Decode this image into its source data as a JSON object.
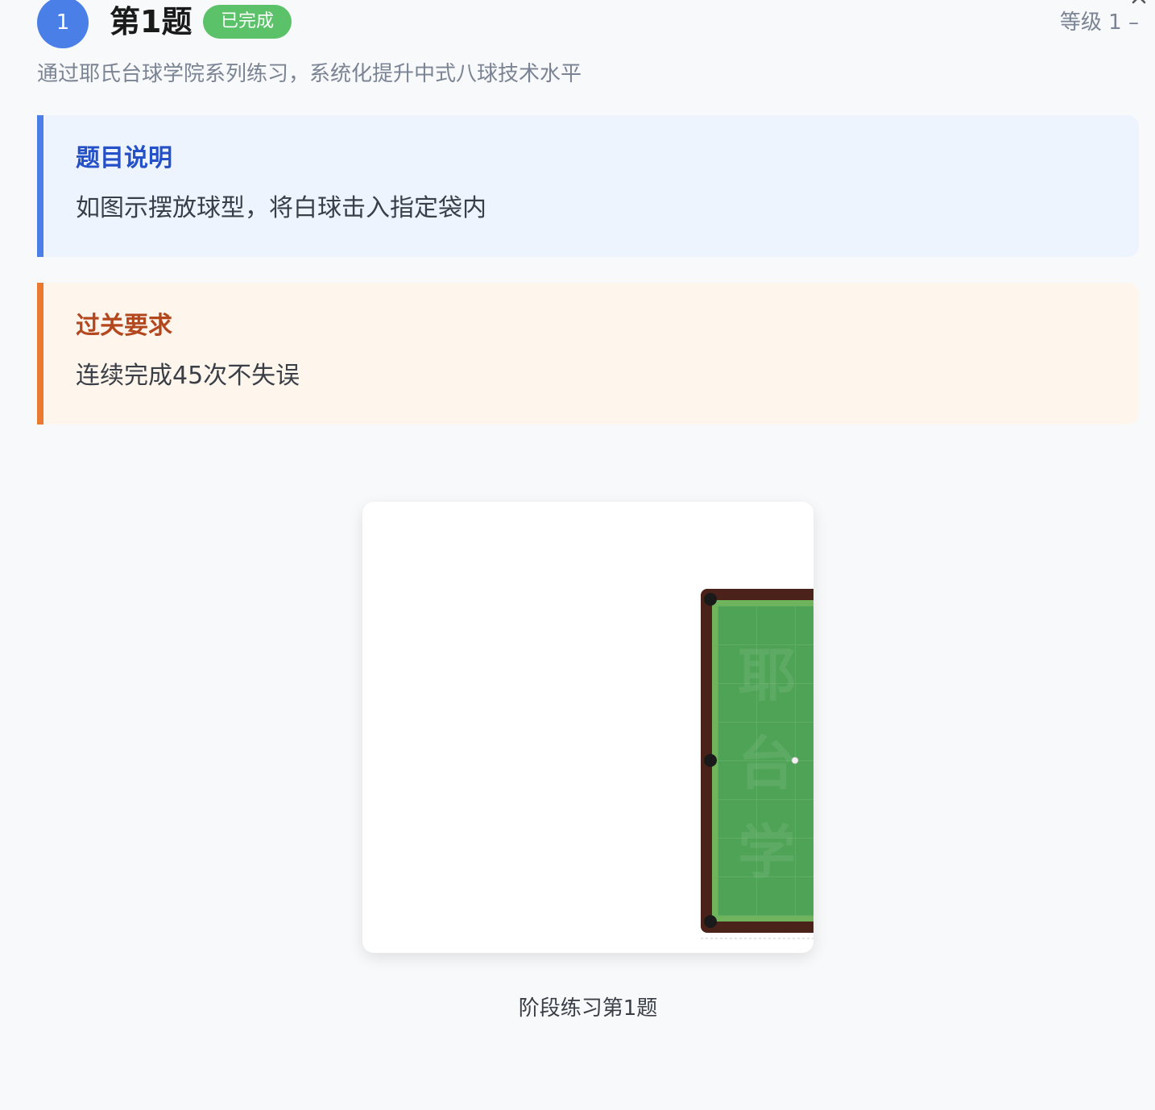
{
  "header": {
    "number": "1",
    "title": "第1题",
    "status": "已完成",
    "level": "等级 1 –"
  },
  "subtitle": "通过耶氏台球学院系列练习，系统化提升中式八球技术水平",
  "description_card": {
    "title": "题目说明",
    "body": "如图示摆放球型，将白球击入指定袋内"
  },
  "requirement_card": {
    "title": "过关要求",
    "body": "连续完成45次不失误"
  },
  "table_image": {
    "watermark_lines": [
      "耶",
      "台",
      "学"
    ],
    "colors": {
      "felt": "#4fa356",
      "rail": "#4a2219",
      "cushion": "#6fb35c",
      "pocket": "#1a1a1a"
    }
  },
  "caption": "阶段练习第1题"
}
